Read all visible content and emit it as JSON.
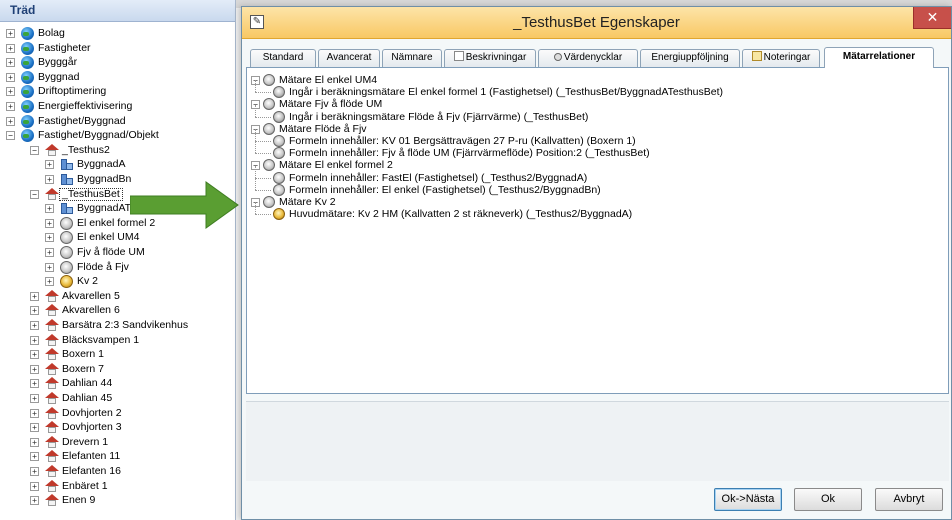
{
  "tree": {
    "header": "Träd",
    "items": [
      {
        "label": "Bolag",
        "level": 0,
        "icon": "globe-icon",
        "exp": "+"
      },
      {
        "label": "Fastigheter",
        "level": 0,
        "icon": "globe-icon",
        "exp": "+"
      },
      {
        "label": "Bygggår",
        "level": 0,
        "icon": "globe-icon",
        "exp": "+"
      },
      {
        "label": "Byggnad",
        "level": 0,
        "icon": "globe-icon",
        "exp": "+"
      },
      {
        "label": "Driftoptimering",
        "level": 0,
        "icon": "globe-icon",
        "exp": "+"
      },
      {
        "label": "Energieffektivisering",
        "level": 0,
        "icon": "globe-icon",
        "exp": "+"
      },
      {
        "label": "Fastighet/Byggnad",
        "level": 0,
        "icon": "globe-icon",
        "exp": "+"
      },
      {
        "label": "Fastighet/Byggnad/Objekt",
        "level": 0,
        "icon": "globe-icon",
        "exp": "−"
      },
      {
        "label": "_Testhus2",
        "level": 1,
        "icon": "house-icon",
        "exp": "−"
      },
      {
        "label": "ByggnadA",
        "level": 2,
        "icon": "building-icon",
        "exp": "+"
      },
      {
        "label": "ByggnadBn",
        "level": 2,
        "icon": "building-icon",
        "exp": "+"
      },
      {
        "label": "_TesthusBet",
        "level": 1,
        "icon": "house-icon",
        "exp": "−",
        "selected": true
      },
      {
        "label": "ByggnadATesthusBet",
        "level": 2,
        "icon": "building-icon",
        "exp": "+"
      },
      {
        "label": "El enkel formel 2",
        "level": 2,
        "icon": "meter-icon",
        "exp": "+"
      },
      {
        "label": "El enkel UM4",
        "level": 2,
        "icon": "meter-icon",
        "exp": "+"
      },
      {
        "label": "Fjv å flöde UM",
        "level": 2,
        "icon": "meter-icon",
        "exp": "+"
      },
      {
        "label": "Flöde å Fjv",
        "level": 2,
        "icon": "meter-icon",
        "exp": "+"
      },
      {
        "label": "Kv 2",
        "level": 2,
        "icon": "meter-gold-icon",
        "exp": "+"
      },
      {
        "label": "Akvarellen 5",
        "level": 1,
        "icon": "house-icon",
        "exp": "+"
      },
      {
        "label": "Akvarellen 6",
        "level": 1,
        "icon": "house-icon",
        "exp": "+"
      },
      {
        "label": "Barsätra 2:3 Sandvikenhus",
        "level": 1,
        "icon": "house-icon",
        "exp": "+"
      },
      {
        "label": "Bläcksvampen 1",
        "level": 1,
        "icon": "house-icon",
        "exp": "+"
      },
      {
        "label": "Boxern 1",
        "level": 1,
        "icon": "house-icon",
        "exp": "+"
      },
      {
        "label": "Boxern 7",
        "level": 1,
        "icon": "house-icon",
        "exp": "+"
      },
      {
        "label": "Dahlian 44",
        "level": 1,
        "icon": "house-icon",
        "exp": "+"
      },
      {
        "label": "Dahlian 45",
        "level": 1,
        "icon": "house-icon",
        "exp": "+"
      },
      {
        "label": "Dovhjorten 2",
        "level": 1,
        "icon": "house-icon",
        "exp": "+"
      },
      {
        "label": "Dovhjorten 3",
        "level": 1,
        "icon": "house-icon",
        "exp": "+"
      },
      {
        "label": "Drevern 1",
        "level": 1,
        "icon": "house-icon",
        "exp": "+"
      },
      {
        "label": "Elefanten 11",
        "level": 1,
        "icon": "house-icon",
        "exp": "+"
      },
      {
        "label": "Elefanten 16",
        "level": 1,
        "icon": "house-icon",
        "exp": "+"
      },
      {
        "label": "Enbäret 1",
        "level": 1,
        "icon": "house-icon",
        "exp": "+"
      },
      {
        "label": "Enen 9",
        "level": 1,
        "icon": "house-icon",
        "exp": "+"
      }
    ]
  },
  "dialog": {
    "title": "_TesthusBet Egenskaper",
    "close": "✕",
    "tabs": [
      {
        "label": "Standard"
      },
      {
        "label": "Avancerat"
      },
      {
        "label": "Nämnare"
      },
      {
        "label": "Beskrivningar"
      },
      {
        "label": "Värdenycklar"
      },
      {
        "label": "Energiuppföljning"
      },
      {
        "label": "Noteringar"
      },
      {
        "label": "Mätarrelationer",
        "active": true
      }
    ],
    "relations": [
      {
        "label": "Mätare El enkel UM4",
        "level": 0,
        "icon": "meter-icon"
      },
      {
        "label": "Ingår i beräkningsmätare El enkel formel 1 (Fastighetsel) (_TesthusBet/ByggnadATesthusBet)",
        "level": 1,
        "icon": "formula-meter-icon"
      },
      {
        "label": "Mätare Fjv å flöde UM",
        "level": 0,
        "icon": "meter-icon"
      },
      {
        "label": "Ingår i beräkningsmätare Flöde å Fjv (Fjärrvärme) (_TesthusBet)",
        "level": 1,
        "icon": "formula-meter-icon"
      },
      {
        "label": "Mätare Flöde å Fjv",
        "level": 0,
        "icon": "meter-icon"
      },
      {
        "label": "Formeln innehåller: KV 01 Bergsättravägen 27 P-ru (Kallvatten) (Boxern 1)",
        "level": 1,
        "icon": "meter-icon"
      },
      {
        "label": "Formeln innehåller: Fjv å flöde UM (Fjärrvärmeflöde) Position:2 (_TesthusBet)",
        "level": 1,
        "icon": "meter-icon"
      },
      {
        "label": "Mätare El enkel formel 2",
        "level": 0,
        "icon": "meter-icon"
      },
      {
        "label": "Formeln innehåller: FastEl (Fastighetsel) (_Testhus2/ByggnadA)",
        "level": 1,
        "icon": "meter-icon"
      },
      {
        "label": "Formeln innehåller: El enkel (Fastighetsel) (_Testhus2/ByggnadBn)",
        "level": 1,
        "icon": "meter-icon"
      },
      {
        "label": "Mätare Kv 2",
        "level": 0,
        "icon": "meter-icon"
      },
      {
        "label": "Huvudmätare: Kv 2 HM  (Kallvatten 2 st räkneverk) (_Testhus2/ByggnadA)",
        "level": 1,
        "icon": "meter-gold-icon"
      }
    ],
    "buttons": {
      "ok_next": "Ok->Nästa",
      "ok": "Ok",
      "cancel": "Avbryt"
    }
  },
  "colors": {
    "arrow": "#5a9e32",
    "titlebar": "#f8c864",
    "close": "#c7504a"
  }
}
